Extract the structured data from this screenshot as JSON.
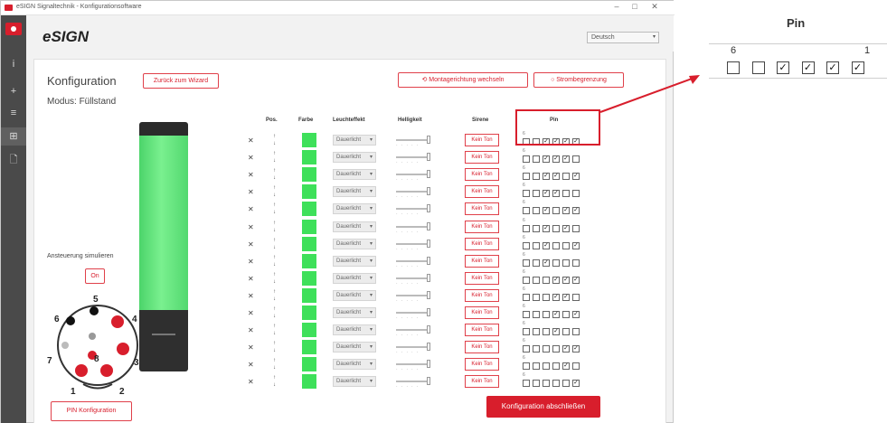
{
  "window": {
    "title": "eSIGN Signaltechnik - Konfigurationsoftware",
    "minimize": "–",
    "maximize": "□",
    "close": "✕"
  },
  "header": {
    "brand": "eSIGN",
    "language": "Deutsch"
  },
  "sidebar": {
    "items": [
      "i",
      "+",
      "≡",
      "⊞",
      "🗋"
    ]
  },
  "page": {
    "heading": "Konfiguration",
    "back_button": "Zurück zum Wizard",
    "mode_label": "Modus: Füllstand",
    "mount_button": "Montagerichtung wechseln",
    "current_button": "Strombegrenzung",
    "simulate_label": "Ansteuerung simulieren",
    "simulate_button": "On",
    "pin_config_button": "PIN Konfiguration",
    "save_button": "Konfiguration abschließen"
  },
  "table": {
    "headers": {
      "pos": "Pos.",
      "color": "Farbe",
      "mode": "Leuchteffekt",
      "brightness": "Helligkeit",
      "tone": "Sirene",
      "pin": "Pin"
    },
    "mode_value": "Dauerlicht",
    "tone_value": "Kein Ton",
    "pin_high": "6",
    "pin_low": "1",
    "rows": [
      [
        0,
        0,
        1,
        1,
        1,
        1
      ],
      [
        0,
        0,
        1,
        1,
        1,
        0
      ],
      [
        0,
        0,
        1,
        1,
        0,
        1
      ],
      [
        0,
        0,
        1,
        1,
        0,
        0
      ],
      [
        0,
        0,
        1,
        0,
        1,
        1
      ],
      [
        0,
        0,
        1,
        0,
        1,
        0
      ],
      [
        0,
        0,
        1,
        0,
        0,
        1
      ],
      [
        0,
        0,
        1,
        0,
        0,
        0
      ],
      [
        0,
        0,
        0,
        1,
        1,
        1
      ],
      [
        0,
        0,
        0,
        1,
        1,
        0
      ],
      [
        0,
        0,
        0,
        1,
        0,
        1
      ],
      [
        0,
        0,
        0,
        1,
        0,
        0
      ],
      [
        0,
        0,
        0,
        0,
        1,
        1
      ],
      [
        0,
        0,
        0,
        0,
        1,
        0
      ],
      [
        0,
        0,
        0,
        0,
        0,
        1
      ]
    ]
  },
  "connector": {
    "pins": [
      "1",
      "2",
      "3",
      "4",
      "5",
      "6",
      "7",
      "8"
    ],
    "active_pins": [
      "3",
      "4",
      "8",
      "2"
    ],
    "accent": "#d81e2c"
  },
  "zoom": {
    "title": "Pin",
    "label_high": "6",
    "label_low": "1",
    "states": [
      0,
      0,
      1,
      1,
      1,
      1
    ]
  }
}
